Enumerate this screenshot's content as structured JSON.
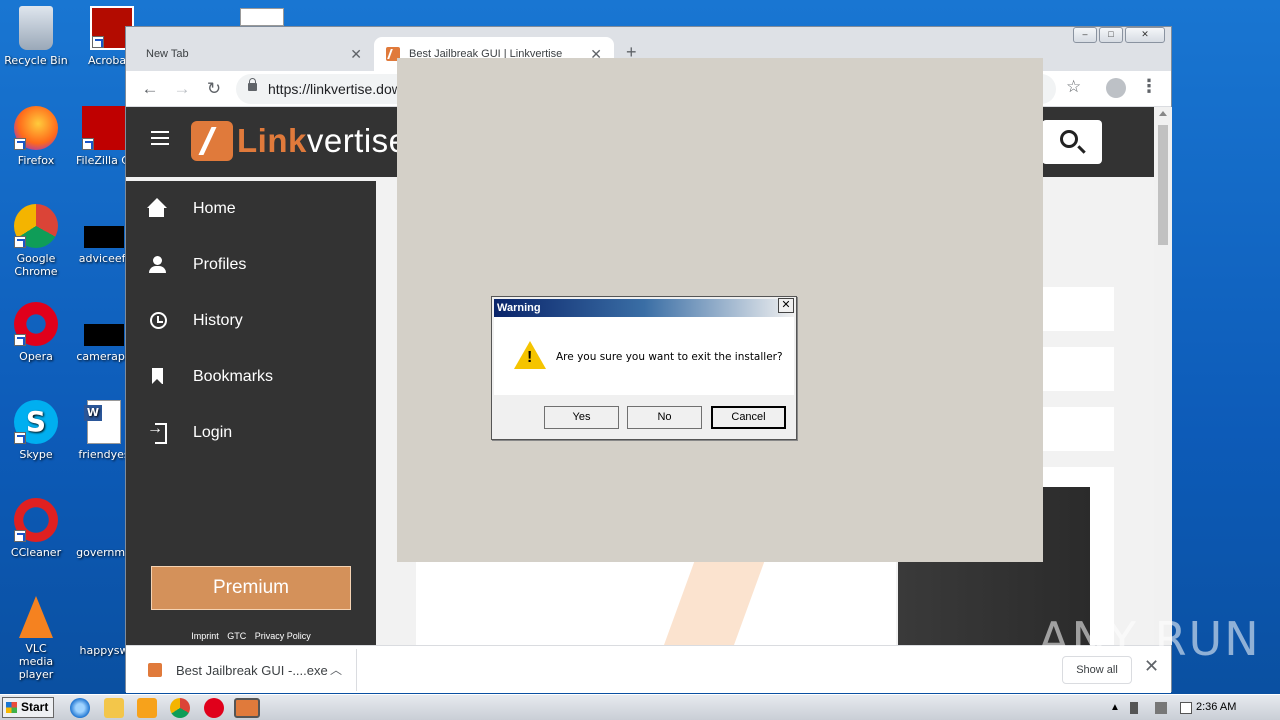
{
  "desktop": {
    "icons": [
      {
        "label": "Recycle Bin"
      },
      {
        "label": "Acrobat Reader"
      },
      {
        "label": "Firefox"
      },
      {
        "label": "FileZilla Cl"
      },
      {
        "label": "Google Chrome"
      },
      {
        "label": "adviceeff"
      },
      {
        "label": "Opera"
      },
      {
        "label": "camerapa"
      },
      {
        "label": "Skype"
      },
      {
        "label": "friendyes"
      },
      {
        "label": "CCleaner"
      },
      {
        "label": "governme"
      },
      {
        "label": "VLC media player"
      },
      {
        "label": "happysw"
      }
    ]
  },
  "browser": {
    "tabs": [
      {
        "title": "New Tab"
      },
      {
        "title": "Best Jailbreak GUI | Linkvertise"
      }
    ],
    "url": "https://linkvertise.dow",
    "win_controls": {
      "min": "‒",
      "max": "□",
      "close": "✕"
    }
  },
  "site": {
    "logo_link": "Link",
    "logo_rest": "vertise",
    "nav": [
      {
        "label": "Home",
        "icon": "home-icon"
      },
      {
        "label": "Profiles",
        "icon": "profile-icon"
      },
      {
        "label": "History",
        "icon": "history-icon"
      },
      {
        "label": "Bookmarks",
        "icon": "bookmark-icon"
      },
      {
        "label": "Login",
        "icon": "login-icon"
      }
    ],
    "premium_label": "Premium",
    "footer_links": [
      "Imprint",
      "GTC",
      "Privacy Policy"
    ]
  },
  "download_bar": {
    "item_name": "Best Jailbreak GUI -....exe",
    "show_all": "Show all"
  },
  "dialog": {
    "title": "Warning",
    "message": "Are you sure you want to exit the installer?",
    "buttons": {
      "yes": "Yes",
      "no": "No",
      "cancel": "Cancel"
    }
  },
  "watermark": "ANY RUN",
  "taskbar": {
    "start": "Start",
    "time": "2:36 AM"
  },
  "colors": {
    "brand_orange": "#e07a3b",
    "premium": "#d4915a",
    "site_dark": "#333333",
    "desktop_blue": "#1565c4"
  }
}
